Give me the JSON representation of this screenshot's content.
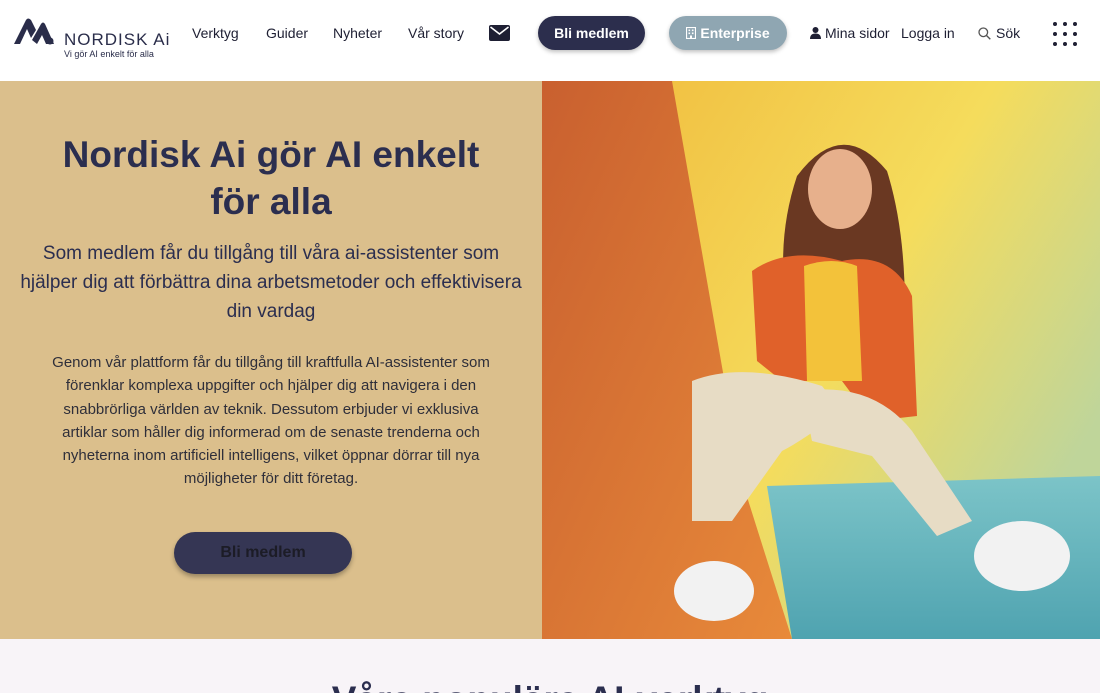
{
  "brand": {
    "name": "NORDISK Ai",
    "tagline": "Vi gör AI enkelt för alla"
  },
  "nav": {
    "items": [
      {
        "label": "Verktyg"
      },
      {
        "label": "Guider"
      },
      {
        "label": "Nyheter"
      },
      {
        "label": "Vår story"
      }
    ],
    "mail_icon": "envelope-icon",
    "member_button": "Bli medlem",
    "enterprise_button": "Enterprise",
    "my_pages": "Mina sidor",
    "login": "Logga in",
    "search": "Sök"
  },
  "hero": {
    "title": "Nordisk Ai gör AI enkelt för alla",
    "subtitle": "Som medlem får du tillgång till våra ai-assistenter som hjälper dig att förbättra dina arbetsmetoder och effektivisera din vardag",
    "body": "Genom vår plattform får du tillgång till kraftfulla AI-assistenter som förenklar komplexa uppgifter och hjälper dig att navigera i den snabbrörliga världen av teknik. Dessutom erbjuder vi exklusiva artiklar som håller dig informerad om de senaste trenderna och nyheterna inom artificiell intelligens, vilket öppnar dörrar till nya möjligheter för ditt företag.",
    "cta": "Bli medlem"
  },
  "next_section": {
    "title": "Våra populära AI-verktyg"
  },
  "colors": {
    "navy": "#2c2e4d",
    "enterprise": "#8fa6b2",
    "hero_bg": "#dbbf8c",
    "section_bg": "#f8f4f8"
  }
}
